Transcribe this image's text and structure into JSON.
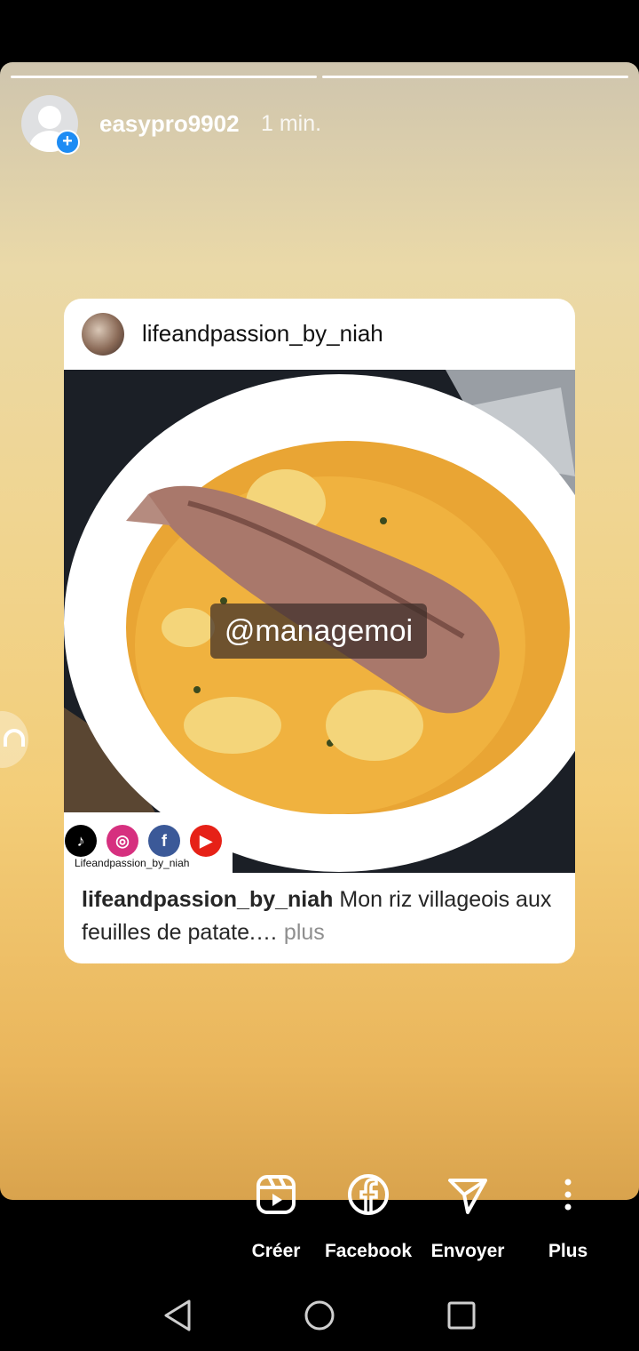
{
  "story": {
    "username": "easypro9902",
    "time": "1 min.",
    "progress_segments": 2
  },
  "post": {
    "author": "lifeandpassion_by_niah",
    "watermark": "@managemoi",
    "social_handle": "Lifeandpassion_by_niah",
    "caption_author": "lifeandpassion_by_niah",
    "caption_text": " Mon riz villageois aux feuilles de patate.…",
    "caption_more": " plus"
  },
  "actions": [
    {
      "label": "Créer",
      "icon": "reels-icon"
    },
    {
      "label": "Facebook",
      "icon": "facebook-icon"
    },
    {
      "label": "Envoyer",
      "icon": "send-icon"
    },
    {
      "label": "Plus",
      "icon": "more-vertical-icon"
    }
  ],
  "colors": {
    "badge": "#1d8cf4",
    "story_top": "#cfc5ae",
    "story_bottom": "#d9a34d"
  }
}
